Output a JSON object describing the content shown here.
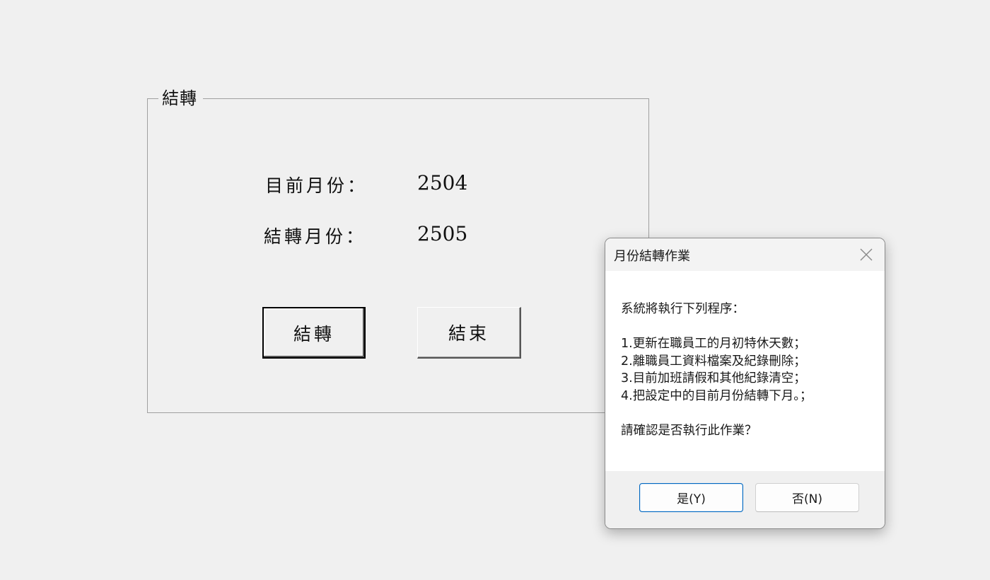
{
  "window": {
    "groupbox_title": "結轉",
    "current_month_label": "目前月份：",
    "current_month_value": "2504",
    "transfer_month_label": "結轉月份：",
    "transfer_month_value": "2505",
    "transfer_button": "結轉",
    "end_button": "結束"
  },
  "dialog": {
    "title": "月份結轉作業",
    "close_icon": "close-icon",
    "message": {
      "intro": "系統將執行下列程序：",
      "steps": [
        "1.更新在職員工的月初特休天數；",
        "2.離職員工資料檔案及紀錄刪除；",
        "3.目前加班請假和其他紀錄清空；",
        "4.把設定中的目前月份結轉下月。；"
      ],
      "confirm": "請確認是否執行此作業？"
    },
    "yes_button": "是(Y)",
    "no_button": "否(N)"
  },
  "colors": {
    "background": "#f0f0f0",
    "dialog_primary_border": "#0067c0"
  }
}
